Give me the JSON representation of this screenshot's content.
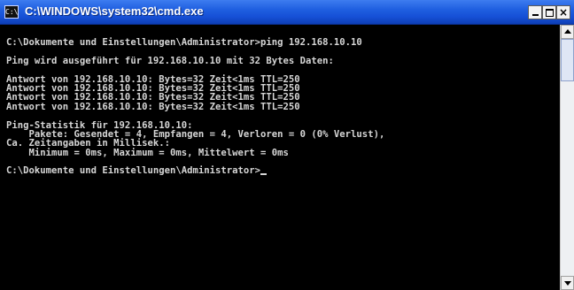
{
  "window": {
    "title": "C:\\WINDOWS\\system32\\cmd.exe",
    "icon_name": "cmd-icon",
    "icon_text": "C:\\",
    "controls": {
      "minimize": "minimize-icon",
      "maximize": "maximize-icon",
      "close": "×"
    },
    "colors": {
      "titlebar": "#1f5fe0",
      "console_bg": "#000000",
      "console_text": "#d6d6d6"
    }
  },
  "console": {
    "lines": [
      "C:\\Dokumente und Einstellungen\\Administrator>ping 192.168.10.10",
      "",
      "Ping wird ausgeführt für 192.168.10.10 mit 32 Bytes Daten:",
      "",
      "Antwort von 192.168.10.10: Bytes=32 Zeit<1ms TTL=250",
      "Antwort von 192.168.10.10: Bytes=32 Zeit<1ms TTL=250",
      "Antwort von 192.168.10.10: Bytes=32 Zeit<1ms TTL=250",
      "Antwort von 192.168.10.10: Bytes=32 Zeit<1ms TTL=250",
      "",
      "Ping-Statistik für 192.168.10.10:",
      "    Pakete: Gesendet = 4, Empfangen = 4, Verloren = 0 (0% Verlust),",
      "Ca. Zeitangaben in Millisek.:",
      "    Minimum = 0ms, Maximum = 0ms, Mittelwert = 0ms",
      "",
      "C:\\Dokumente und Einstellungen\\Administrator>"
    ]
  },
  "scrollbar": {
    "up_icon": "arrow-up-icon",
    "down_icon": "arrow-down-icon"
  }
}
